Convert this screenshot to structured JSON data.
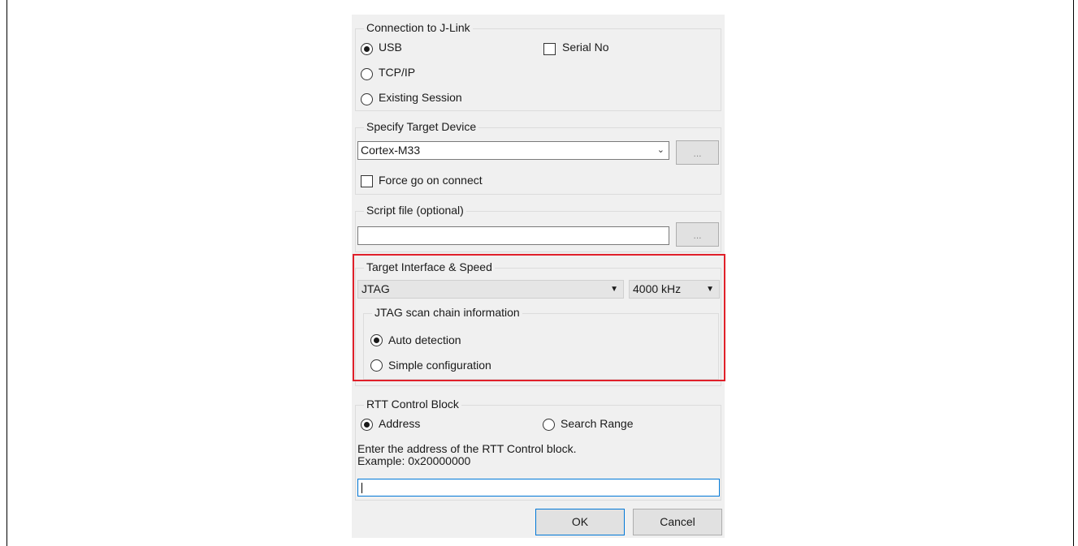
{
  "connection": {
    "title": "Connection to J-Link",
    "usb_label": "USB",
    "tcpip_label": "TCP/IP",
    "existing_label": "Existing Session",
    "serial_label": "Serial No",
    "selected": "USB"
  },
  "target_device": {
    "title": "Specify Target Device",
    "device_value": "Cortex-M33",
    "browse_label": "...",
    "force_go_label": "Force go on connect"
  },
  "script_file": {
    "title": "Script file (optional)",
    "value": "",
    "browse_label": "..."
  },
  "interface": {
    "title": "Target Interface & Speed",
    "interface_value": "JTAG",
    "speed_value": "4000 kHz",
    "scan_chain": {
      "title": "JTAG scan chain information",
      "auto_label": "Auto detection",
      "simple_label": "Simple configuration",
      "selected": "Auto detection"
    }
  },
  "rtt": {
    "title": "RTT Control Block",
    "address_label": "Address",
    "search_range_label": "Search Range",
    "selected": "Address",
    "description_line1": "Enter the address of the RTT Control block.",
    "description_line2": "Example: 0x20000000",
    "address_value": ""
  },
  "buttons": {
    "ok_label": "OK",
    "cancel_label": "Cancel"
  },
  "colors": {
    "highlight": "#e0202a",
    "focus": "#0078d7",
    "dialog_bg": "#f0f0f0"
  }
}
